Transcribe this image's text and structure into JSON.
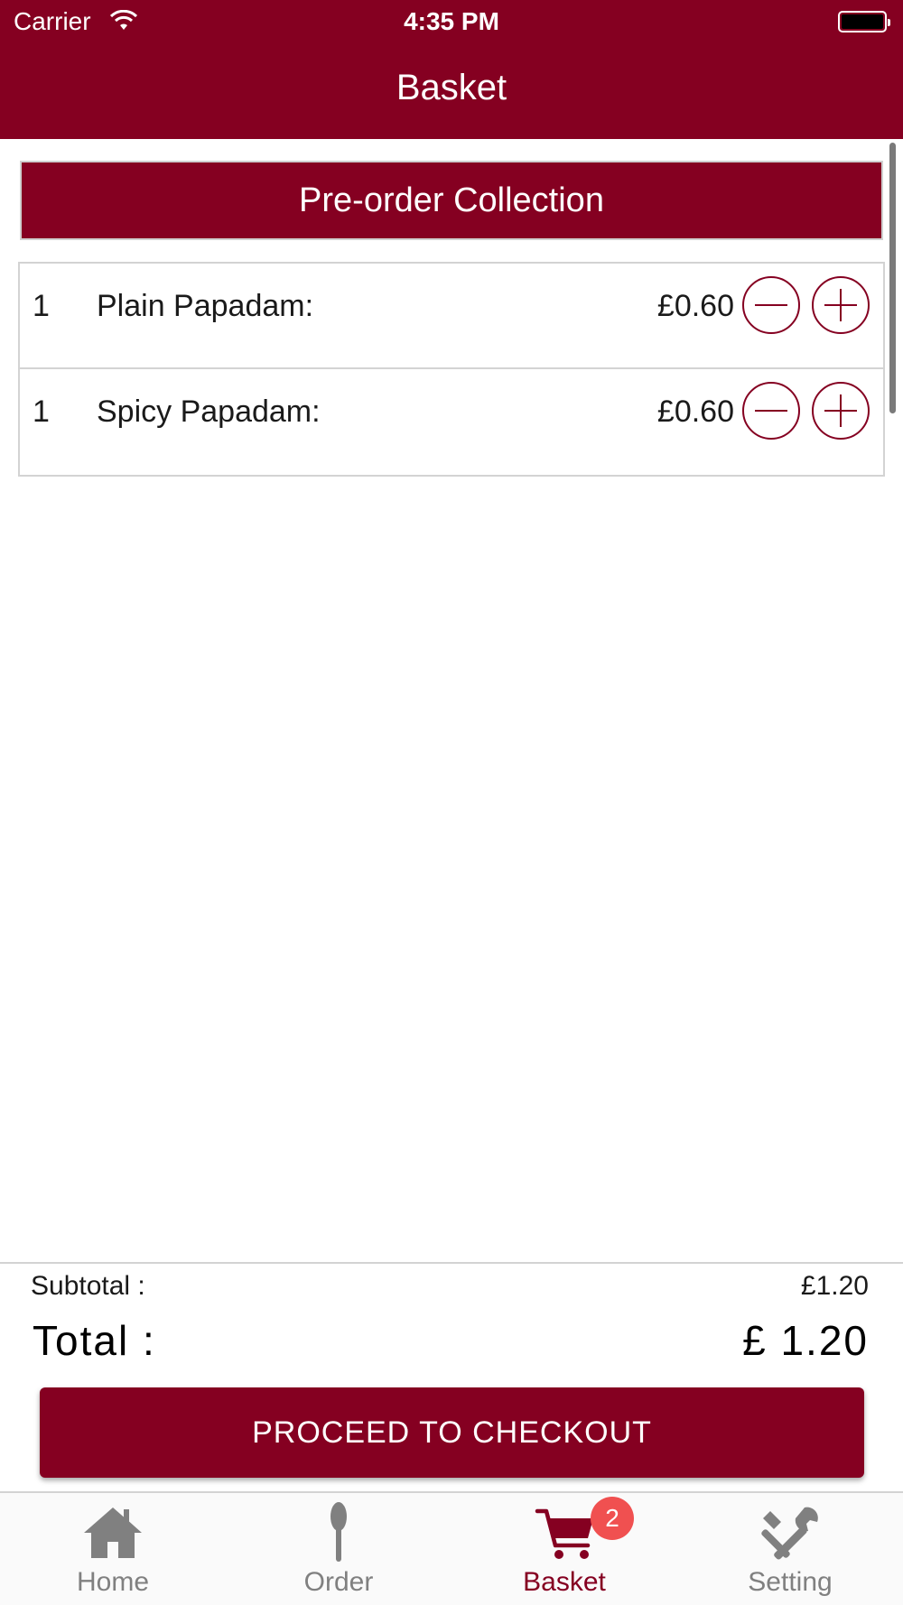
{
  "status_bar": {
    "carrier": "Carrier",
    "time": "4:35 PM"
  },
  "header": {
    "title": "Basket"
  },
  "section": {
    "title": "Pre-order Collection"
  },
  "items": [
    {
      "qty": "1",
      "name": "Plain Papadam:",
      "price": "£0.60"
    },
    {
      "qty": "1",
      "name": "Spicy Papadam:",
      "price": "£0.60"
    }
  ],
  "totals": {
    "subtotal_label": "Subtotal :",
    "subtotal_value": "£1.20",
    "total_label": "Total :",
    "total_value": "£ 1.20"
  },
  "checkout": {
    "label": "PROCEED TO CHECKOUT"
  },
  "tabs": [
    {
      "label": "Home",
      "icon": "home-icon",
      "active": false
    },
    {
      "label": "Order",
      "icon": "spoon-icon",
      "active": false
    },
    {
      "label": "Basket",
      "icon": "cart-icon",
      "active": true,
      "badge": "2"
    },
    {
      "label": "Setting",
      "icon": "tools-icon",
      "active": false
    }
  ],
  "colors": {
    "brand": "#850021",
    "badge": "#f05050",
    "inactive": "#808080"
  }
}
